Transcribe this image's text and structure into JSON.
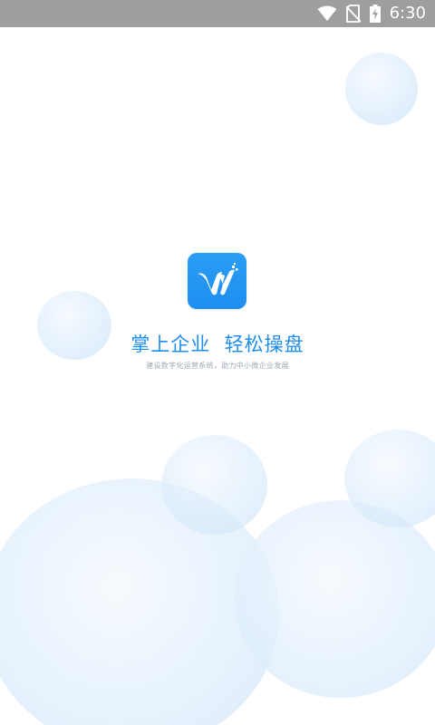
{
  "status_bar": {
    "time": "6:30",
    "icons": [
      "wifi-icon",
      "no-sim-icon",
      "battery-charging-icon"
    ]
  },
  "splash": {
    "logo": "app-logo-icon",
    "slogan": "掌上企业  轻松操盘",
    "sub_slogan": "建设数字化运营系统，助力中小微企业发展"
  },
  "colors": {
    "brand": "#1e8ef0",
    "status_bar": "#9e9e9e",
    "bubble": "#d6e9fa",
    "sub_text": "#9ea7b3"
  }
}
